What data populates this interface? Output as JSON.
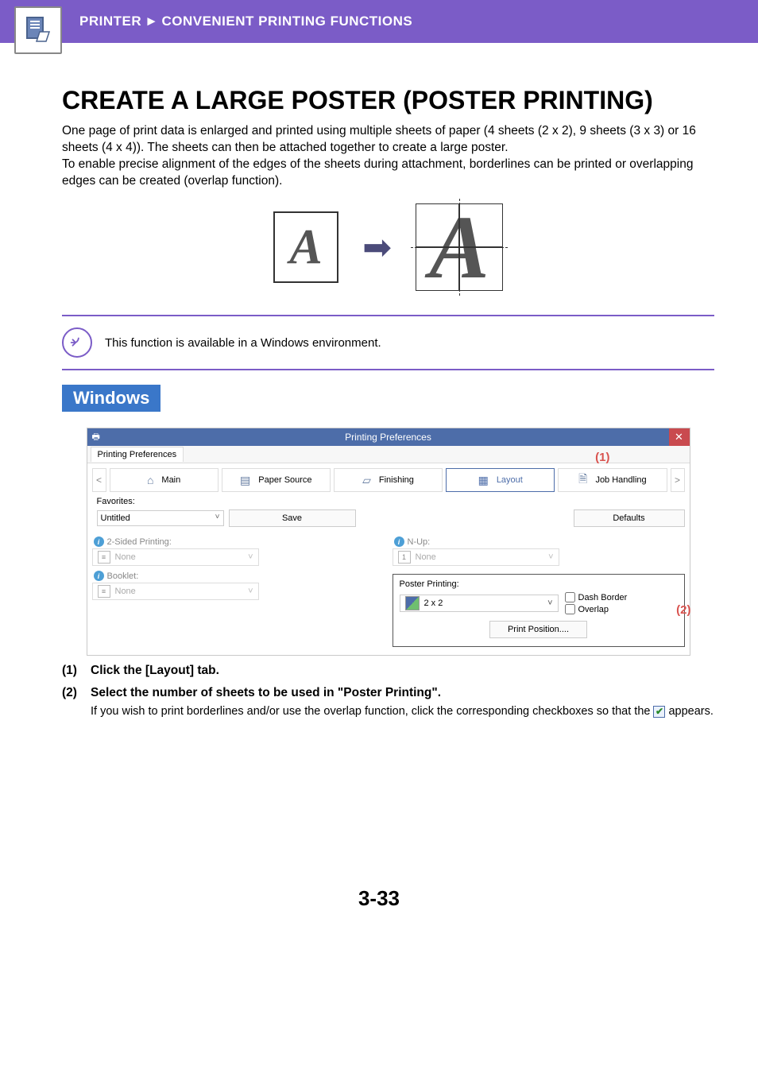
{
  "header": {
    "section": "PRINTER",
    "subsection": "CONVENIENT PRINTING FUNCTIONS",
    "separator": "►"
  },
  "title": "CREATE A LARGE POSTER (POSTER PRINTING)",
  "intro_para1": "One page of print data is enlarged and printed using multiple sheets of paper (4 sheets (2 x 2), 9 sheets (3 x 3) or 16 sheets (4 x 4)). The sheets can then be attached together to create a large poster.",
  "intro_para2": "To enable precise alignment of the edges of the sheets during attachment, borderlines can be printed or overlapping edges can be created (overlap function).",
  "note": "This function is available in a Windows environment.",
  "os_badge": "Windows",
  "dialog": {
    "title": "Printing Preferences",
    "tabstrip": "Printing Preferences",
    "nav_prev": "<",
    "nav_next": ">",
    "tabs": {
      "main": "Main",
      "paper_source": "Paper Source",
      "finishing": "Finishing",
      "layout": "Layout",
      "job_handling": "Job Handling"
    },
    "favorites_label": "Favorites:",
    "favorites_value": "Untitled",
    "save_btn": "Save",
    "defaults_btn": "Defaults",
    "two_sided_label": "2-Sided Printing:",
    "two_sided_value": "None",
    "booklet_label": "Booklet:",
    "booklet_value": "None",
    "nup_label": "N-Up:",
    "nup_value": "None",
    "poster_label": "Poster Printing:",
    "poster_value": "2 x 2",
    "dash_border": "Dash Border",
    "overlap": "Overlap",
    "print_position_btn": "Print Position...."
  },
  "callouts": {
    "one": "(1)",
    "two": "(2)"
  },
  "steps": {
    "s1_num": "(1)",
    "s1_text": "Click the [Layout] tab.",
    "s2_num": "(2)",
    "s2_text": "Select the number of sheets to be used in \"Poster Printing\".",
    "s2_note_a": "If you wish to print borderlines and/or use the overlap function, click the corresponding checkboxes so that the",
    "s2_note_b": "appears."
  },
  "page_number": "3-33"
}
